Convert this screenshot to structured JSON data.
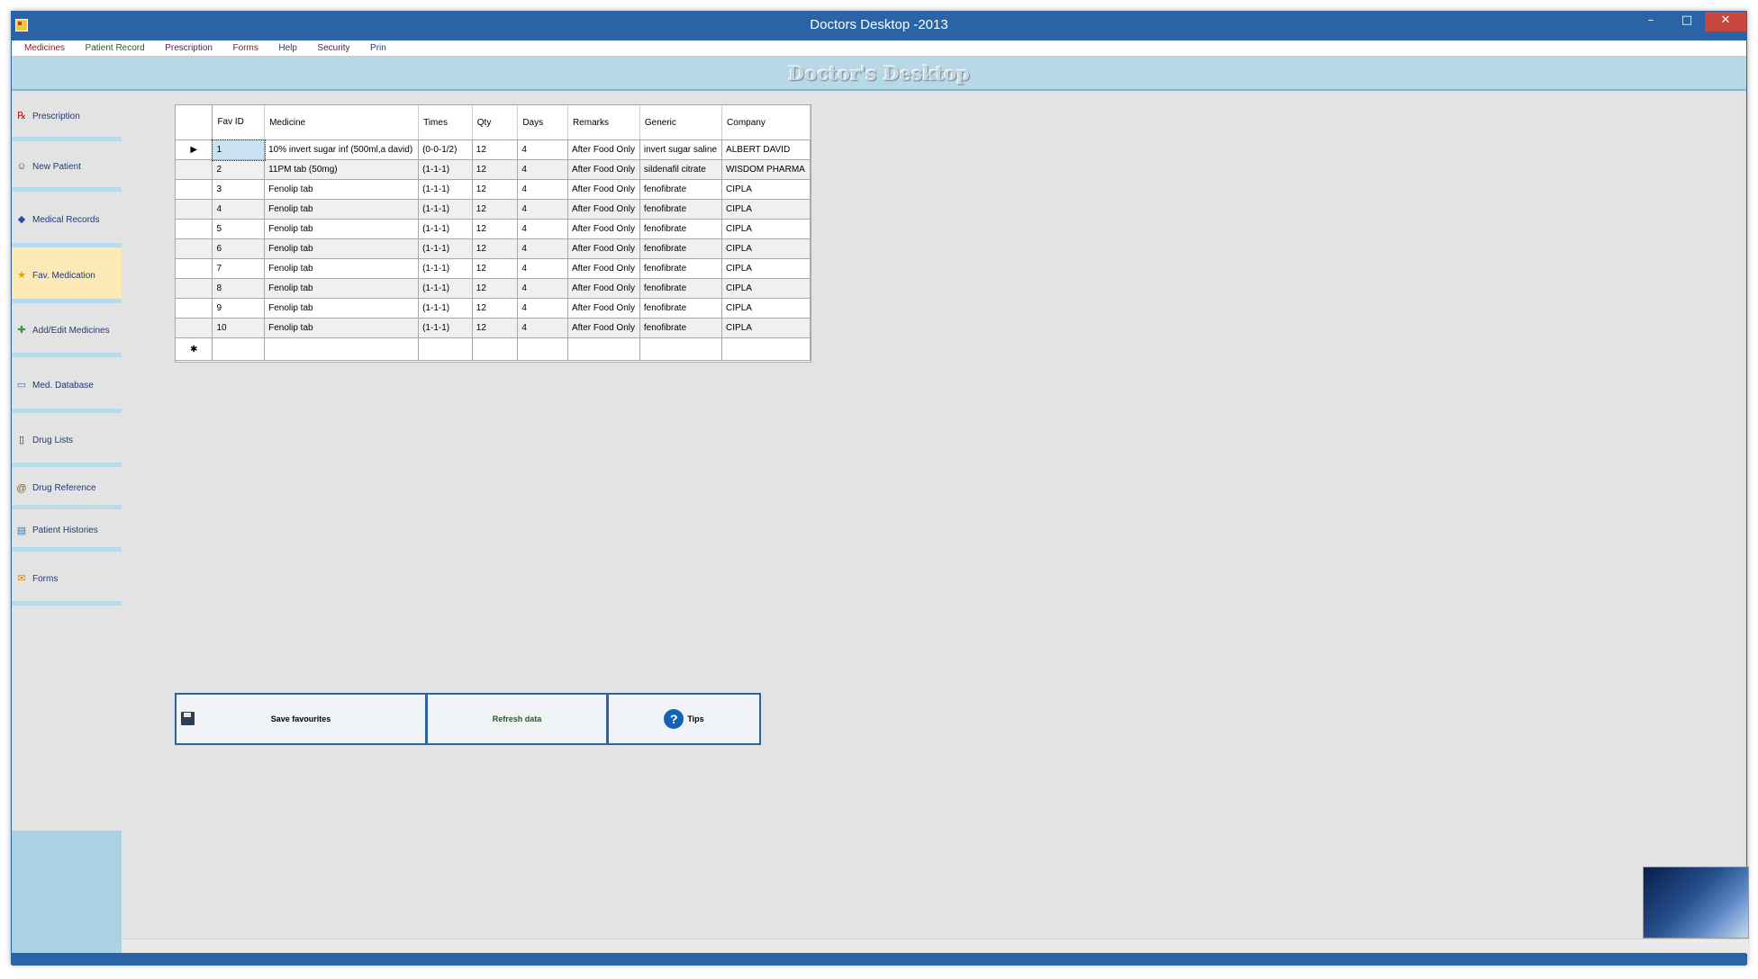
{
  "window": {
    "title": "Doctors Desktop -2013",
    "minimize": "–",
    "maximize": "□",
    "close": "✕"
  },
  "menu": [
    "Medicines",
    "Patient Record",
    "Prescription",
    "Forms",
    "Help",
    "Security",
    "Prin"
  ],
  "menu_colors": [
    "#8b1a1a",
    "#1e5e1e",
    "#5b1060",
    "#8b1a1a",
    "#1f3a78",
    "#5b1060",
    "#1f3a78"
  ],
  "banner": {
    "title": "Doctor's Desktop"
  },
  "sidebar": [
    {
      "label": "Prescription",
      "icon": "prescription-icon",
      "glyph": "℞"
    },
    {
      "label": "New Patient",
      "icon": "patient-icon",
      "glyph": "☺"
    },
    {
      "label": "Medical Records",
      "icon": "records-icon",
      "glyph": "◆"
    },
    {
      "label": "Fav. Medication",
      "icon": "star-icon",
      "glyph": "★",
      "active": true
    },
    {
      "label": "Add/Edit  Medicines",
      "icon": "plus-icon",
      "glyph": "✚"
    },
    {
      "label": "Med. Database",
      "icon": "monitor-icon",
      "glyph": "▭"
    },
    {
      "label": "Drug Lists",
      "icon": "list-icon",
      "glyph": "▯"
    },
    {
      "label": "Drug Reference",
      "icon": "book-icon",
      "glyph": "@"
    },
    {
      "label": "Patient Histories",
      "icon": "history-icon",
      "glyph": "▤"
    },
    {
      "label": "Forms",
      "icon": "forms-icon",
      "glyph": "✉"
    }
  ],
  "grid": {
    "columns": [
      "Fav ID",
      "Medicine",
      "Times",
      "Qty",
      "Days",
      "Remarks",
      "Generic",
      "Company"
    ],
    "rows": [
      [
        "1",
        "10% invert sugar inf (500ml,a david)",
        "(0-0-1/2)",
        "12",
        "4",
        "After Food Only",
        "invert sugar saline",
        "ALBERT DAVID"
      ],
      [
        "2",
        "11PM tab (50mg)",
        "(1-1-1)",
        "12",
        "4",
        "After Food Only",
        "sildenafil citrate",
        "WISDOM PHARMA"
      ],
      [
        "3",
        "Fenolip tab",
        "(1-1-1)",
        "12",
        "4",
        "After Food Only",
        "fenofibrate",
        "CIPLA"
      ],
      [
        "4",
        "Fenolip tab",
        "(1-1-1)",
        "12",
        "4",
        "After Food Only",
        "fenofibrate",
        "CIPLA"
      ],
      [
        "5",
        "Fenolip tab",
        "(1-1-1)",
        "12",
        "4",
        "After Food Only",
        "fenofibrate",
        "CIPLA"
      ],
      [
        "6",
        "Fenolip tab",
        "(1-1-1)",
        "12",
        "4",
        "After Food Only",
        "fenofibrate",
        "CIPLA"
      ],
      [
        "7",
        "Fenolip tab",
        "(1-1-1)",
        "12",
        "4",
        "After Food Only",
        "fenofibrate",
        "CIPLA"
      ],
      [
        "8",
        "Fenolip tab",
        "(1-1-1)",
        "12",
        "4",
        "After Food Only",
        "fenofibrate",
        "CIPLA"
      ],
      [
        "9",
        "Fenolip tab",
        "(1-1-1)",
        "12",
        "4",
        "After Food Only",
        "fenofibrate",
        "CIPLA"
      ],
      [
        "10",
        "Fenolip tab",
        "(1-1-1)",
        "12",
        "4",
        "After Food Only",
        "fenofibrate",
        "CIPLA"
      ]
    ],
    "current_row_marker": "▶",
    "new_row_marker": "✱"
  },
  "buttons": {
    "save": "Save favourites",
    "refresh": "Refresh data",
    "tips": "Tips",
    "tips_glyph": "?"
  },
  "colors": {
    "accent": "#2a64a6",
    "banner": "#b7d9e7",
    "active_item": "#fde9b6"
  }
}
